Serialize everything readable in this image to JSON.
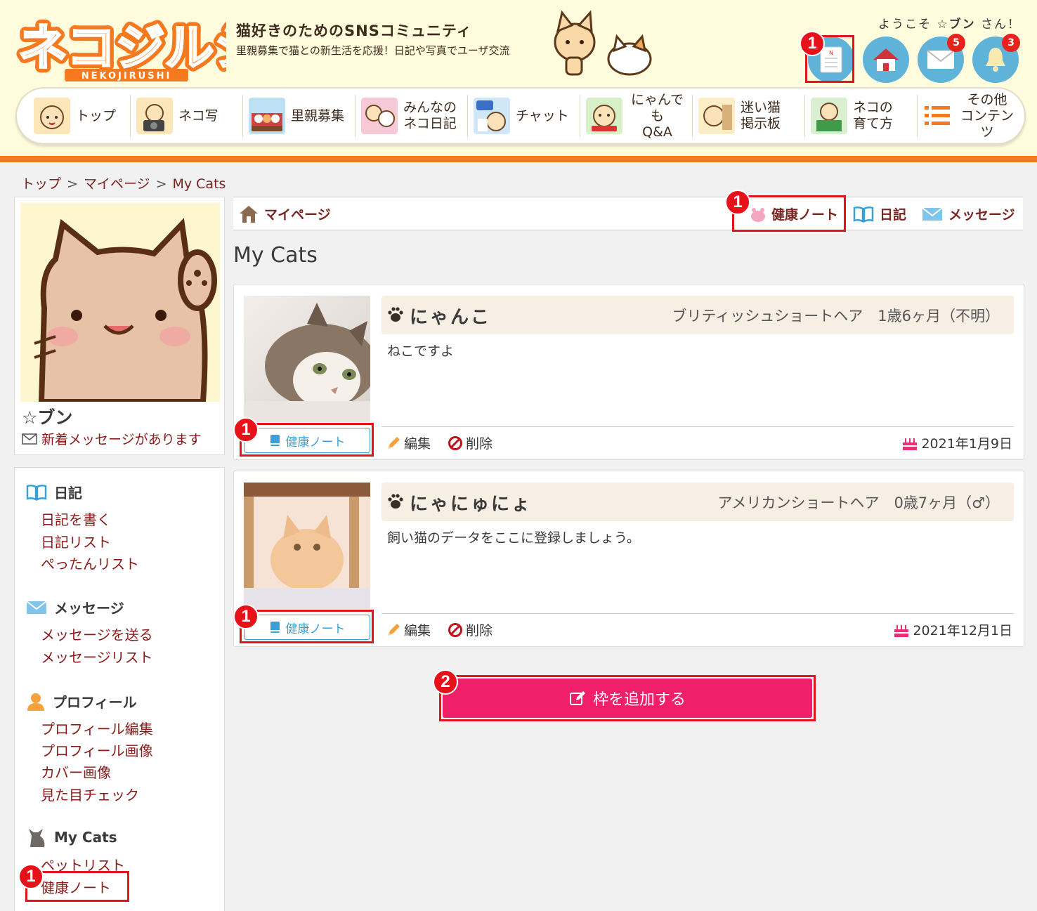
{
  "header": {
    "logo_text": "ネコジルシ",
    "logo_sub": "NEKOJIRUSHI",
    "tagline": "猫好きのためのSNSコミュニティ",
    "subline": "里親募集で猫との新生活を応援！日記や写真でユーザ交流",
    "welcome_prefix": "ようこそ",
    "welcome_user": "☆ブン",
    "welcome_suffix": "さん！",
    "mail_badge": "5",
    "bell_badge": "3"
  },
  "nav": [
    {
      "label": "トップ",
      "icon": "cat-top-icon"
    },
    {
      "label": "ネコ写",
      "icon": "cat-camera-icon"
    },
    {
      "label": "里親募集",
      "icon": "cats-house-icon"
    },
    {
      "label": "みんなの\nネコ日記",
      "icon": "cat-diary-icon"
    },
    {
      "label": "チャット",
      "icon": "cat-chat-icon"
    },
    {
      "label": "にゃんでも\nQ&A",
      "icon": "cat-qa-icon"
    },
    {
      "label": "迷い猫\n掲示板",
      "icon": "cat-board-icon"
    },
    {
      "label": "ネコの\n育て方",
      "icon": "cat-book-icon"
    },
    {
      "label": "その他\nコンテンツ",
      "icon": "list-icon"
    }
  ],
  "breadcrumb": {
    "items": [
      "トップ",
      "マイページ",
      "My Cats"
    ],
    "sep": ">"
  },
  "profile": {
    "name": "☆ブン",
    "new_message": "新着メッセージがあります"
  },
  "sidebar": {
    "diary": {
      "title": "日記",
      "links": [
        "日記を書く",
        "日記リスト",
        "ぺったんリスト"
      ]
    },
    "message": {
      "title": "メッセージ",
      "links": [
        "メッセージを送る",
        "メッセージリスト"
      ]
    },
    "profile": {
      "title": "プロフィール",
      "links": [
        "プロフィール編集",
        "プロフィール画像",
        "カバー画像",
        "見た目チェック"
      ]
    },
    "mycats": {
      "title": "My Cats",
      "links": [
        "ペットリスト",
        "健康ノート"
      ]
    }
  },
  "tabs": {
    "mypage": "マイページ",
    "health": "健康ノート",
    "diary": "日記",
    "message": "メッセージ"
  },
  "page_title": "My Cats",
  "cats": [
    {
      "name": "にゃんこ",
      "breed_age": "ブリティッシュショートヘア　1歳6ヶ月（不明）",
      "desc": "ねこですよ",
      "health": "健康ノート",
      "edit": "編集",
      "delete": "削除",
      "birthday": "2021年1月9日"
    },
    {
      "name": "にゃにゅにょ",
      "breed_age": "アメリカンショートヘア　0歳7ヶ月（♂）",
      "desc": "飼い猫のデータをここに登録しましょう。",
      "health": "健康ノート",
      "edit": "編集",
      "delete": "削除",
      "birthday": "2021年12月1日"
    }
  ],
  "add_button": "枠を追加する",
  "annotations": {
    "one": "1",
    "two": "2"
  },
  "colors": {
    "accent": "#f57a1f",
    "brand_red": "#ef2068",
    "link": "#8b1a1a",
    "marker": "#e8111a"
  }
}
